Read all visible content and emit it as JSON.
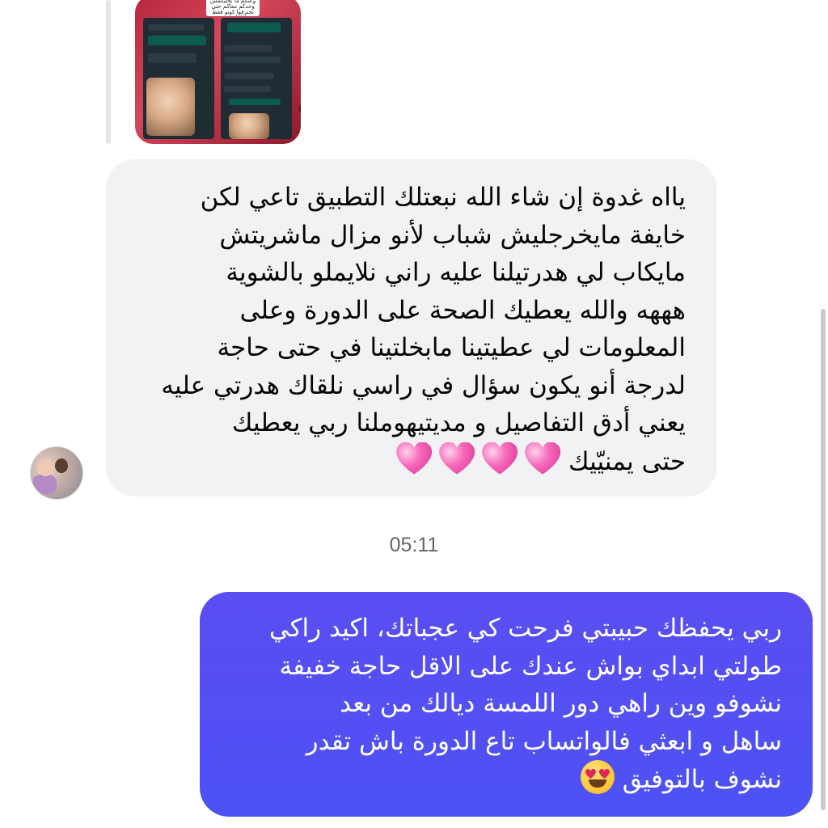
{
  "conversation": {
    "media_preview": {
      "caption": "وعنكم ما نخليكمش وحدكم معاكم حتى تحترفوا كونو فقط شاطرات و ديرو التطبيق يوميا",
      "play_icon": "play-icon"
    },
    "incoming": {
      "lines": [
        "يااه غدوة إن شاء الله نبعتلك التطبيق تاعي لكن",
        "خايفة مايخرجليش شباب لأنو مزال ماشريتش",
        "مايكاب لي هدرتيلنا عليه راني نلايملو بالشوية",
        "هههه والله يعطيك الصحة على الدورة وعلى",
        "المعلومات لي عطيتينا مابخلتينا في حتى حاجة",
        "لدرجة أنو يكون سؤال في راسي نلقاك هدرتي عليه",
        "يعني أدق التفاصيل و مديتيهوملنا ربي يعطيك",
        "حتى يمنيّيك"
      ],
      "emoji": "growing-heart-emoji",
      "emoji_count": 4
    },
    "timestamp": "05:11",
    "outgoing": {
      "lines": [
        "ربي يحفظك حبيبتي فرحت كي عجباتك، اكيد راكي",
        "طولتي ابداي بواش عندك على الاقل حاجة خفيفة",
        "نشوفو وين راهي دور اللمسة ديالك من بعد",
        "ساهل و ابعثي فالواتساب تاع الدورة باش تقدر",
        "نشوف بالتوفيق"
      ],
      "emoji": "heart-eyes-emoji"
    }
  },
  "colors": {
    "incoming_bubble": "#f1f2f4",
    "outgoing_bubble": "#5a4df2",
    "timestamp_text": "#65676b"
  }
}
